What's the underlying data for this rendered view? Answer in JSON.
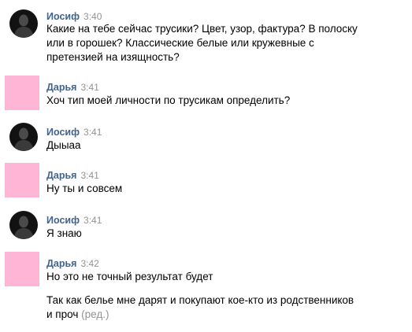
{
  "messages": [
    {
      "author": "Иосиф",
      "time": "3:40",
      "avatar": "male-photo-avatar",
      "lines": [
        "Какие на тебе сейчас трусики? Цвет, узор, фактура? В полоску\nили в горошек? Классические белые или кружевные с\nпретензией на изящность?"
      ]
    },
    {
      "author": "Дарья",
      "time": "3:41",
      "avatar": "pink-square-avatar",
      "lines": [
        "Хоч тип моей личности по трусикам определить?"
      ]
    },
    {
      "author": "Иосиф",
      "time": "3:41",
      "avatar": "male-photo-avatar",
      "lines": [
        "Дыыаа"
      ]
    },
    {
      "author": "Дарья",
      "time": "3:41",
      "avatar": "pink-square-avatar",
      "lines": [
        "Ну ты и совсем"
      ]
    },
    {
      "author": "Иосиф",
      "time": "3:41",
      "avatar": "male-photo-avatar",
      "lines": [
        "Я знаю"
      ]
    },
    {
      "author": "Дарья",
      "time": "3:42",
      "avatar": "pink-square-avatar",
      "lines": [
        "Но это не точный результат будет",
        "Так как белье мне дарят и покупают кое-кто из родственников\nи проч"
      ],
      "edited_label": "(ред.)"
    }
  ],
  "colors": {
    "author": "#42648b",
    "time": "#939393",
    "text": "#000000",
    "pink_avatar": "#ffb5d5",
    "background": "#ffffff"
  }
}
